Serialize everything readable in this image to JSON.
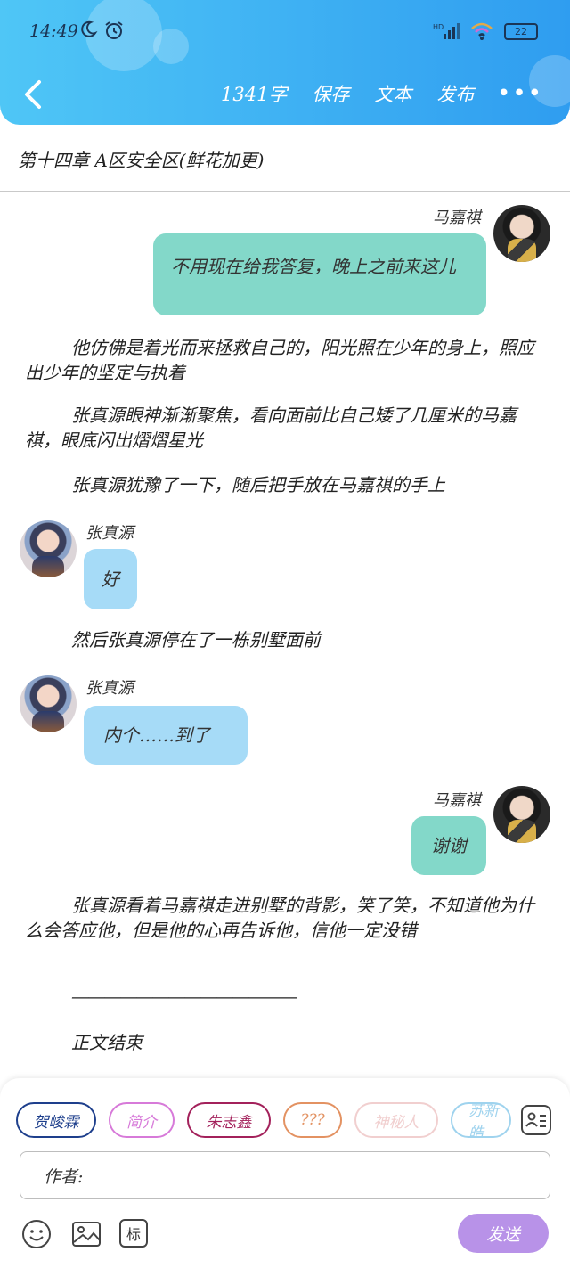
{
  "status_bar": {
    "time": "14:49",
    "hd": "HD",
    "battery": "22"
  },
  "header": {
    "word_count": "1341字",
    "save_label": "保存",
    "text_label": "文本",
    "publish_label": "发布",
    "more": "•••"
  },
  "chapter_title": "第十四章 A区安全区(鲜花加更)",
  "messages": [
    {
      "speaker": "马嘉祺",
      "text": "不用现在给我答复，晚上之前来这儿"
    },
    {
      "narration": "他仿佛是着光而来拯救自己的，阳光照在少年的身上，照应出少年的坚定与执着"
    },
    {
      "narration": "张真源眼神渐渐聚焦，看向面前比自己矮了几厘米的马嘉祺，眼底闪出熠熠星光"
    },
    {
      "narration": "张真源犹豫了一下，随后把手放在马嘉祺的手上"
    },
    {
      "speaker": "张真源",
      "text": "好"
    },
    {
      "narration": "然后张真源停在了一栋别墅面前"
    },
    {
      "speaker": "张真源",
      "text": "内个……到了"
    },
    {
      "speaker": "马嘉祺",
      "text": "谢谢"
    },
    {
      "narration": "张真源看着马嘉祺走进别墅的背影，笑了笑，不知道他为什么会答应他，但是他的心再告诉他，信他一定没错"
    },
    {
      "narration": "——————————————"
    },
    {
      "narration": "正文结束"
    }
  ],
  "characters": [
    {
      "name": "贺峻霖",
      "color": "#1e3f8c"
    },
    {
      "name": "简介",
      "color": "#d77ad9"
    },
    {
      "name": "朱志鑫",
      "color": "#a3215b"
    },
    {
      "name": "???",
      "color": "#e39262"
    },
    {
      "name": "神秘人",
      "color": "#f1cfcf"
    },
    {
      "name": "苏新皓",
      "color": "#9fd3ee"
    }
  ],
  "author_field": {
    "label": "作者:"
  },
  "bottom_toolbar": {
    "tag_label": "标",
    "send_label": "发送"
  },
  "colors": {
    "header_gradient_start": "#4fc6f6",
    "header_gradient_end": "#2f9df0",
    "bubble_green": "#83d8c9",
    "bubble_blue": "#a6dbf7",
    "send_button": "#b892e8"
  }
}
